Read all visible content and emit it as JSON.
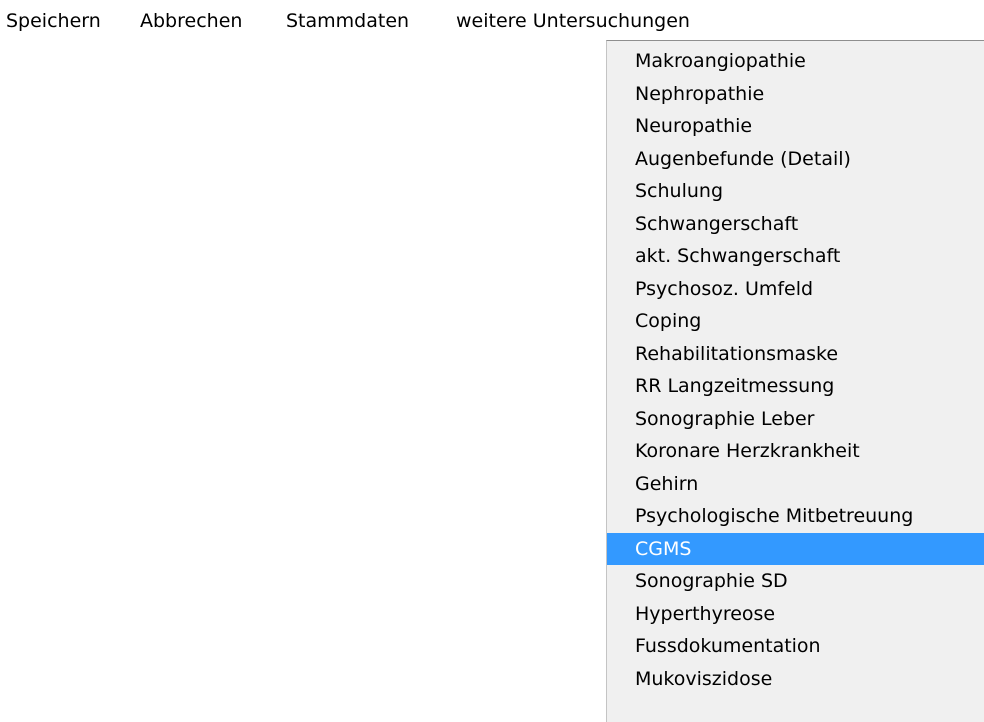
{
  "menubar": {
    "items": [
      "Speichern",
      "Abbrechen",
      "Stammdaten",
      "weitere Untersuchungen"
    ]
  },
  "dropdown": {
    "selected_label": "CGMS",
    "selected_color": "#3399ff",
    "items": [
      "Makroangiopathie",
      "Nephropathie",
      "Neuropathie",
      "Augenbefunde (Detail)",
      "Schulung",
      "Schwangerschaft",
      "akt. Schwangerschaft",
      "Psychosoz. Umfeld",
      "Coping",
      "Rehabilitationsmaske",
      "RR Langzeitmessung",
      "Sonographie Leber",
      "Koronare Herzkrankheit",
      "Gehirn",
      "Psychologische Mitbetreuung",
      "CGMS",
      "Sonographie SD",
      "Hyperthyreose",
      "Fussdokumentation",
      "Mukoviszidose"
    ]
  }
}
